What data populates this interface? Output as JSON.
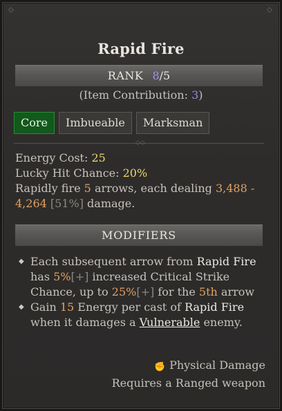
{
  "tooltip": {
    "title": "Rapid Fire",
    "rank": {
      "label": "RANK",
      "current": "8",
      "sep": "/",
      "max": "5"
    },
    "contribution": {
      "prefix": "(Item Contribution: ",
      "value": "3",
      "suffix": ")"
    },
    "tags": [
      "Core",
      "Imbueable",
      "Marksman"
    ],
    "stats": {
      "energy_cost_label": "Energy Cost: ",
      "energy_cost": "25",
      "lucky_hit_label": "Lucky Hit Chance: ",
      "lucky_hit": "20%",
      "desc_a": "Rapidly fire ",
      "arrows": "5",
      "desc_b": " arrows, each dealing ",
      "dmg_min": "3,488",
      "dash": " -",
      "dmg_max": "4,264",
      "pct": " [51%]",
      "desc_c": " damage."
    },
    "modifiers_label": "MODIFIERS",
    "modifiers": [
      {
        "t1": "Each subsequent arrow from ",
        "skill": "Rapid Fire",
        "t2": " has ",
        "v1": "5%",
        "b1": "[+]",
        "t3": " increased Critical Strike Chance, up to ",
        "v2": "25%",
        "b2": "[+]",
        "t4": " for the ",
        "v3": "5th",
        "t5": " arrow"
      },
      {
        "t1": "Gain ",
        "v1": "15",
        "t2": " Energy per cast of ",
        "skill": "Rapid Fire",
        "t3": " when it damages a ",
        "keyword": "Vulnerable",
        "t4": " enemy."
      }
    ],
    "damage_type": "Physical Damage",
    "requirement": "Requires a Ranged weapon",
    "icons": {
      "damage_type_icon": "fist-icon",
      "bullet_icon": "diamond-bullet-icon"
    },
    "colors": {
      "yellow": "#ecd56d",
      "orange": "#e2a163",
      "rank_purple": "#9a95e8",
      "core_tag": "#12591c"
    }
  }
}
